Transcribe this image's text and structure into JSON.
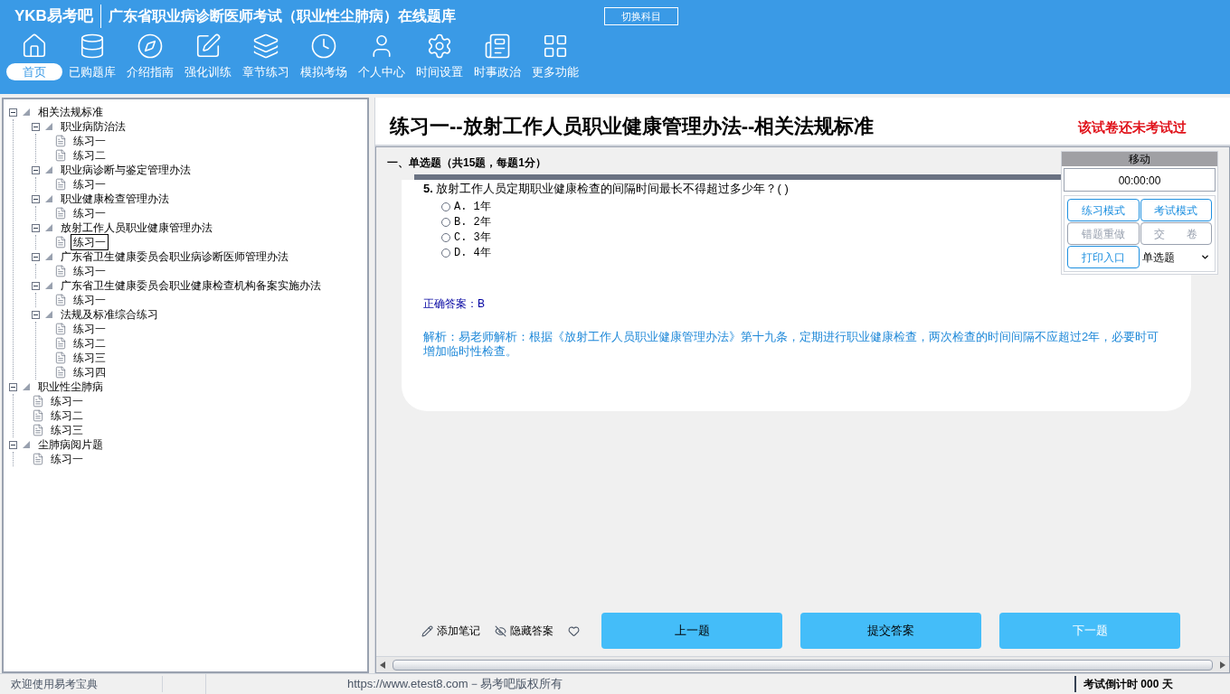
{
  "header": {
    "logo": "YKB易考吧",
    "title": "广东省职业病诊断医师考试（职业性尘肺病）在线题库",
    "switch_button": "切换科目"
  },
  "nav": [
    {
      "label": "首页",
      "selected": true
    },
    {
      "label": "已购题库",
      "selected": false
    },
    {
      "label": "介绍指南",
      "selected": false
    },
    {
      "label": "强化训练",
      "selected": false
    },
    {
      "label": "章节练习",
      "selected": false
    },
    {
      "label": "模拟考场",
      "selected": false
    },
    {
      "label": "个人中心",
      "selected": false
    },
    {
      "label": "时间设置",
      "selected": false
    },
    {
      "label": "时事政治",
      "selected": false
    },
    {
      "label": "更多功能",
      "selected": false
    }
  ],
  "tree": [
    {
      "label": "相关法规标准",
      "selected": false,
      "children": [
        {
          "label": "职业病防治法",
          "selected": false,
          "children": [
            {
              "label": "练习一",
              "selected": false
            },
            {
              "label": "练习二",
              "selected": false
            }
          ]
        },
        {
          "label": "职业病诊断与鉴定管理办法",
          "selected": false,
          "children": [
            {
              "label": "练习一",
              "selected": false
            }
          ]
        },
        {
          "label": "职业健康检查管理办法",
          "selected": false,
          "children": [
            {
              "label": "练习一",
              "selected": false
            }
          ]
        },
        {
          "label": "放射工作人员职业健康管理办法",
          "selected": false,
          "children": [
            {
              "label": "练习一",
              "selected": true
            }
          ]
        },
        {
          "label": "广东省卫生健康委员会职业病诊断医师管理办法",
          "selected": false,
          "children": [
            {
              "label": "练习一",
              "selected": false
            }
          ]
        },
        {
          "label": "广东省卫生健康委员会职业健康检查机构备案实施办法",
          "selected": false,
          "children": [
            {
              "label": "练习一",
              "selected": false
            }
          ]
        },
        {
          "label": "法规及标准综合练习",
          "selected": false,
          "children": [
            {
              "label": "练习一",
              "selected": false
            },
            {
              "label": "练习二",
              "selected": false
            },
            {
              "label": "练习三",
              "selected": false
            },
            {
              "label": "练习四",
              "selected": false
            }
          ]
        }
      ]
    },
    {
      "label": "职业性尘肺病",
      "selected": false,
      "children": [
        {
          "label": "练习一",
          "selected": false
        },
        {
          "label": "练习二",
          "selected": false
        },
        {
          "label": "练习三",
          "selected": false
        }
      ]
    },
    {
      "label": "尘肺病阅片题",
      "selected": false,
      "children": [
        {
          "label": "练习一",
          "selected": false
        }
      ]
    }
  ],
  "paper": {
    "title": "练习一--放射工作人员职业健康管理办法--相关法规标准",
    "status": "该试卷还未考试过",
    "section": "一、单选题（共15题，每题1分）"
  },
  "question": {
    "number": "5.",
    "text": "放射工作人员定期职业健康检查的间隔时间最长不得超过多少年？( )",
    "options": [
      {
        "label": "A. 1年",
        "selected": false
      },
      {
        "label": "B. 2年",
        "selected": false
      },
      {
        "label": "C. 3年",
        "selected": false
      },
      {
        "label": "D. 4年",
        "selected": false
      }
    ],
    "answer": "正确答案：B",
    "explanation": "解析：易老师解析：根据《放射工作人员职业健康管理办法》第十九条，定期进行职业健康检查，两次检查的时间间隔不应超过2年，必要时可增加临时性检查。"
  },
  "panel": {
    "title": "移动",
    "timer": "00:00:00",
    "buttons": [
      {
        "label": "练习模式",
        "disabled": false
      },
      {
        "label": "考试模式",
        "disabled": false
      },
      {
        "label": "错题重做",
        "disabled": true
      },
      {
        "label": "交　　卷",
        "disabled": true
      },
      {
        "label": "打印入口",
        "disabled": false
      }
    ],
    "type_select": "单选题"
  },
  "tools": [
    "添加笔记",
    "隐藏答案"
  ],
  "actions": [
    "上一题",
    "提交答案",
    "下一题"
  ],
  "status_bar": {
    "welcome": "欢迎使用易考宝典",
    "copyright": "https://www.etest8.com－易考吧版权所有",
    "countdown": "考试倒计时 000 天"
  }
}
